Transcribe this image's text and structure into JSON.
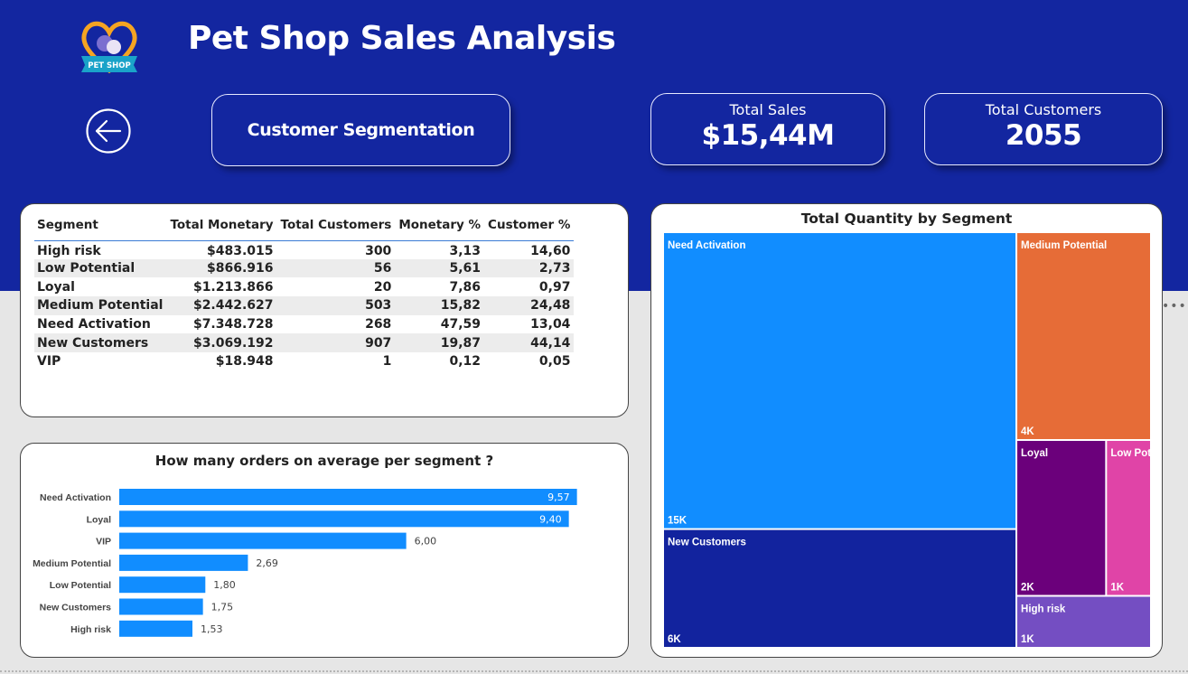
{
  "header": {
    "title": "Pet Shop Sales Analysis",
    "logo_text": "PET SHOP",
    "nav_button": "Customer Segmentation"
  },
  "kpis": [
    {
      "label": "Total Sales",
      "value": "$15,44M"
    },
    {
      "label": "Total Customers",
      "value": "2055"
    }
  ],
  "segment_table": {
    "columns": [
      "Segment",
      "Total Monetary",
      "Total Customers",
      "Monetary %",
      "Customer %"
    ],
    "rows": [
      [
        "High risk",
        "$483.015",
        "300",
        "3,13",
        "14,60"
      ],
      [
        "Low Potential",
        "$866.916",
        "56",
        "5,61",
        "2,73"
      ],
      [
        "Loyal",
        "$1.213.866",
        "20",
        "7,86",
        "0,97"
      ],
      [
        "Medium Potential",
        "$2.442.627",
        "503",
        "15,82",
        "24,48"
      ],
      [
        "Need Activation",
        "$7.348.728",
        "268",
        "47,59",
        "13,04"
      ],
      [
        "New Customers",
        "$3.069.192",
        "907",
        "19,87",
        "44,14"
      ],
      [
        "VIP",
        "$18.948",
        "1",
        "0,12",
        "0,05"
      ]
    ]
  },
  "chart_data": [
    {
      "type": "bar",
      "orientation": "horizontal",
      "title": "How many orders on average per segment ?",
      "categories": [
        "Need Activation",
        "Loyal",
        "VIP",
        "Medium Potential",
        "Low Potential",
        "New Customers",
        "High risk"
      ],
      "values": [
        9.57,
        9.4,
        6.0,
        2.69,
        1.8,
        1.75,
        1.53
      ],
      "labels": [
        "9,57",
        "9,40",
        "6,00",
        "2,69",
        "1,80",
        "1,75",
        "1,53"
      ],
      "xlim": [
        0,
        11.05
      ],
      "color": "#118dff",
      "grid": false,
      "legend": "none"
    },
    {
      "type": "treemap",
      "title": "Total Quantity by Segment",
      "items": [
        {
          "name": "Need Activation",
          "label": "15K",
          "value": 15,
          "color": "#118dff"
        },
        {
          "name": "New Customers",
          "label": "6K",
          "value": 6,
          "color": "#12239e"
        },
        {
          "name": "Medium Potential",
          "label": "4K",
          "value": 4,
          "color": "#e66c37"
        },
        {
          "name": "Loyal",
          "label": "2K",
          "value": 2,
          "color": "#6b007b"
        },
        {
          "name": "Low Pot...",
          "label": "1K",
          "value": 1,
          "color": "#e044a7"
        },
        {
          "name": "High risk",
          "label": "1K",
          "value": 1,
          "color": "#744ec2"
        }
      ]
    }
  ]
}
